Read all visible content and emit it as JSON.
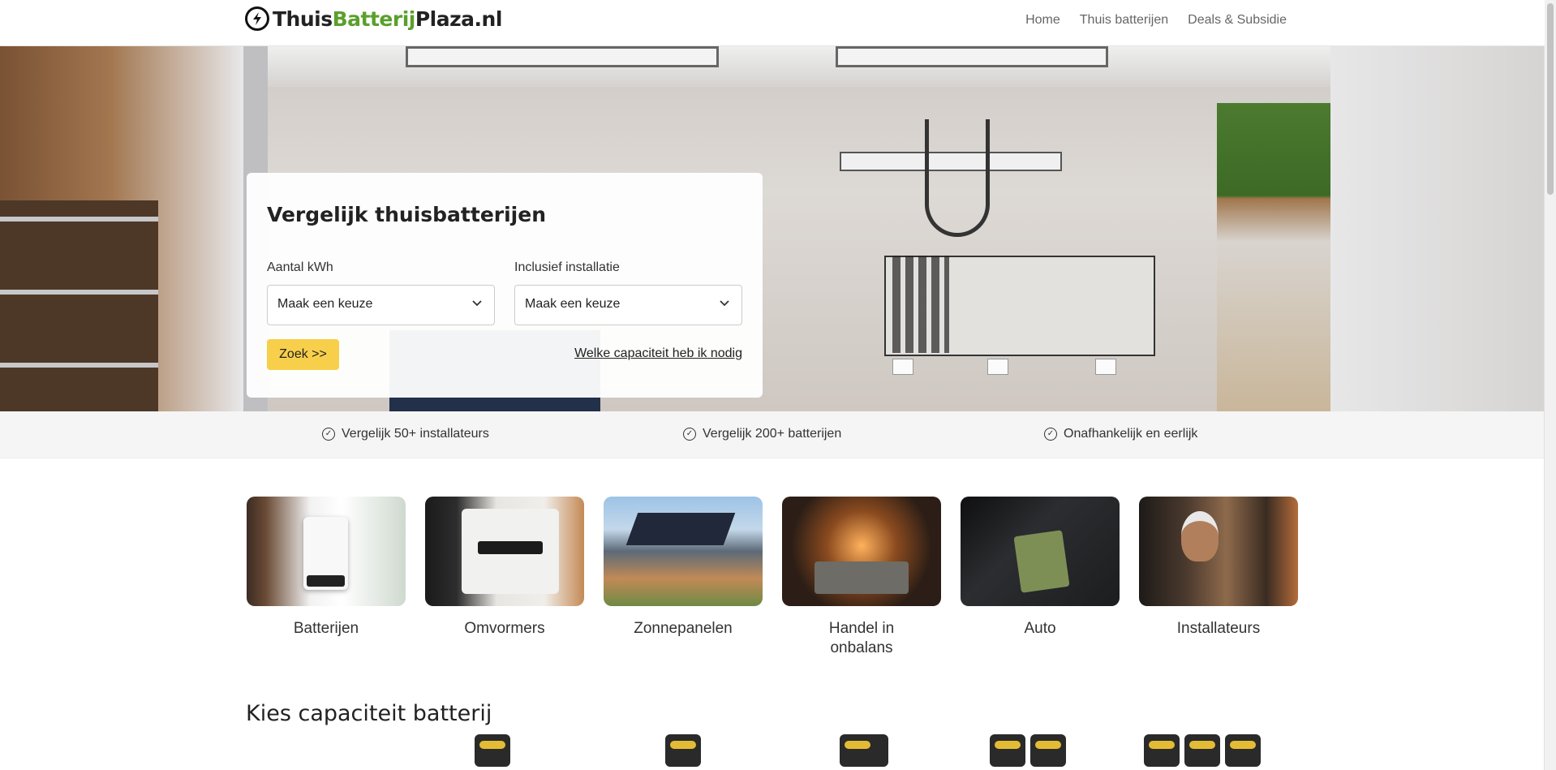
{
  "header": {
    "logo": {
      "part1": "Thuis",
      "part2": "Batterij",
      "part3": "Plaza.nl"
    },
    "nav": [
      "Home",
      "Thuis batterijen",
      "Deals & Subsidie"
    ]
  },
  "search": {
    "title": "Vergelijk thuisbatterijen",
    "kwh_label": "Aantal kWh",
    "kwh_value": "Maak een keuze",
    "install_label": "Inclusief installatie",
    "install_value": "Maak een keuze",
    "button": "Zoek >>",
    "help_link": "Welke capaciteit heb ik nodig"
  },
  "features": [
    "Vergelijk 50+ installateurs",
    "Vergelijk 200+ batterijen",
    "Onafhankelijk en eerlijk"
  ],
  "categories": [
    {
      "label": "Batterijen"
    },
    {
      "label": "Omvormers"
    },
    {
      "label": "Zonnepanelen"
    },
    {
      "label": "Handel in onbalans"
    },
    {
      "label": "Auto"
    },
    {
      "label": "Installateurs"
    }
  ],
  "capacity": {
    "title": "Kies capaciteit batterij"
  },
  "colors": {
    "accent": "#5aa02c",
    "button": "#f7cf4a"
  }
}
